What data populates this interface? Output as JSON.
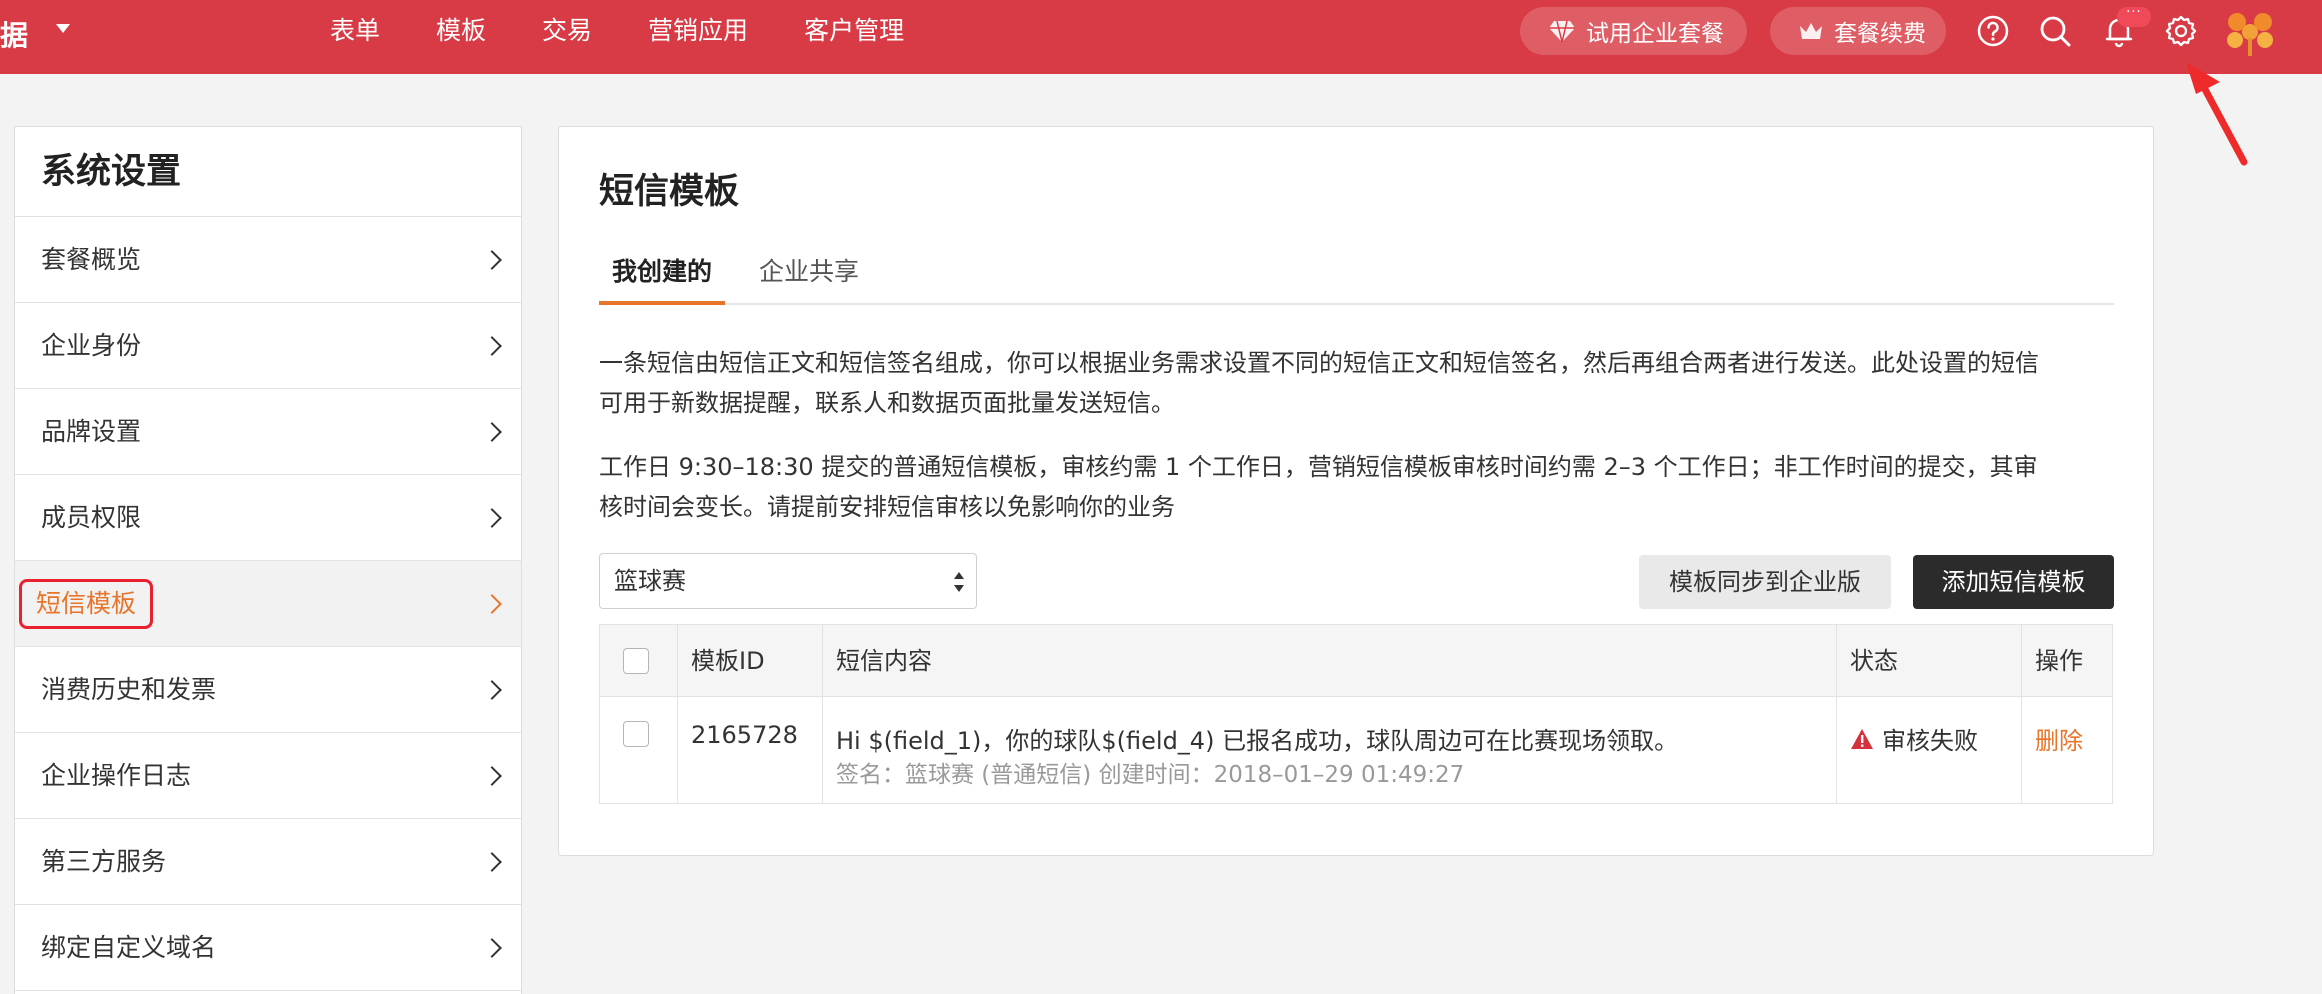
{
  "colors": {
    "topbar": "#d83b45",
    "accent": "#e8742a",
    "highlight_box": "#e8232f",
    "dark_button": "#2b2b2b",
    "warning": "#d6303f"
  },
  "topbar": {
    "brand": "据",
    "nav": [
      "表单",
      "模板",
      "交易",
      "营销应用",
      "客户管理"
    ],
    "trial_label": "试用企业套餐",
    "renew_label": "套餐续费",
    "notify_badge": "···",
    "icons": [
      "diamond-icon",
      "crown-icon",
      "help-icon",
      "search-icon",
      "bell-icon",
      "gear-icon",
      "avatar-flower-icon"
    ]
  },
  "sidebar": {
    "title": "系统设置",
    "items": [
      {
        "label": "套餐概览"
      },
      {
        "label": "企业身份"
      },
      {
        "label": "品牌设置"
      },
      {
        "label": "成员权限"
      },
      {
        "label": "短信模板",
        "active": true
      },
      {
        "label": "消费历史和发票"
      },
      {
        "label": "企业操作日志"
      },
      {
        "label": "第三方服务"
      },
      {
        "label": "绑定自定义域名"
      }
    ]
  },
  "main": {
    "title": "短信模板",
    "tabs": [
      {
        "label": "我创建的",
        "active": true
      },
      {
        "label": "企业共享"
      }
    ],
    "desc1_line1": "一条短信由短信正文和短信签名组成，你可以根据业务需求设置不同的短信正文和短信签名，然后再组合两者进行发送。此处设置的短信",
    "desc1_line2": "可用于新数据提醒，联系人和数据页面批量发送短信。",
    "desc2_line1": "工作日 9:30–18:30 提交的普通短信模板，审核约需 1 个工作日，营销短信模板审核时间约需 2–3 个工作日；非工作时间的提交，其审",
    "desc2_line2": "核时间会变长。请提前安排短信审核以免影响你的业务",
    "select_value": "篮球赛",
    "sync_button": "模板同步到企业版",
    "add_button": "添加短信模板",
    "table": {
      "headers": [
        "模板ID",
        "短信内容",
        "状态",
        "操作"
      ],
      "rows": [
        {
          "id": "2165728",
          "content": "Hi $(field_1)，你的球队$(field_4) 已报名成功，球队周边可在比赛现场领取。",
          "meta": "签名：篮球赛 (普通短信) 创建时间：2018–01–29 01:49:27",
          "status": "审核失败",
          "action": "删除"
        }
      ]
    }
  }
}
